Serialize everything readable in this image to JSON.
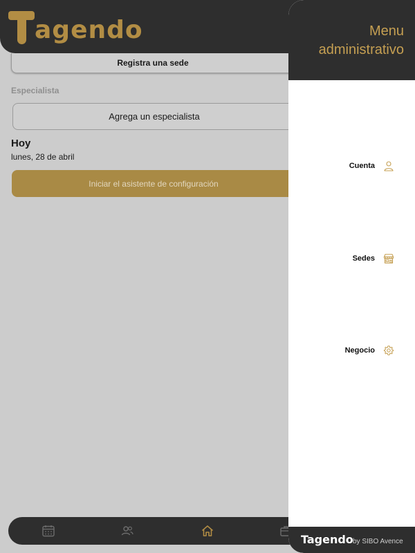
{
  "header": {
    "logo_text": "agendo"
  },
  "main": {
    "register_sede_label": "Registra una sede",
    "especialista_section_label": "Especialista",
    "add_especialista_label": "Agrega un especialista",
    "today_title": "Hoy",
    "today_date": "lunes, 28 de abril",
    "wizard_button_label": "Iniciar el asistente de configuración"
  },
  "bottom_nav": {
    "icons": [
      "calendar-icon",
      "people-icon",
      "home-icon",
      "briefcase-icon"
    ]
  },
  "drawer": {
    "title": "Menu administrativo",
    "items": [
      {
        "label": "Cuenta",
        "icon": "user-icon"
      },
      {
        "label": "Sedes",
        "icon": "store-icon"
      },
      {
        "label": "Negocio",
        "icon": "gear-icon"
      }
    ],
    "footer_logo": "Tagendo",
    "footer_by": "by SIBO Avence"
  },
  "colors": {
    "brand_gold": "#b28d44",
    "dark": "#2e2e2e",
    "overlay_gray": "#cccccc"
  }
}
